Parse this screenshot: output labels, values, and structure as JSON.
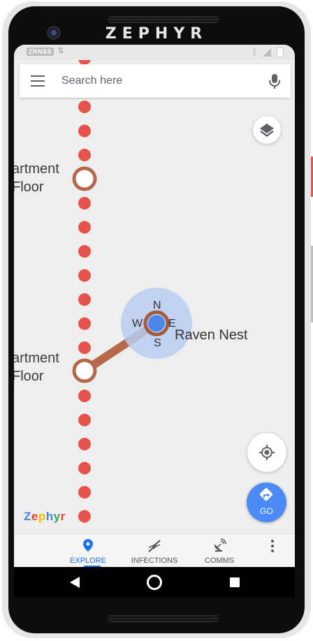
{
  "device": {
    "brand": "ZEPHYR"
  },
  "status_bar": {
    "carrier": "ZRNSS",
    "data_icon": "data-arrows-icon",
    "bluetooth_icon": "bluetooth-icon",
    "signal_icon": "signal-icon",
    "battery_icon": "battery-icon"
  },
  "search": {
    "placeholder": "Search here"
  },
  "map": {
    "labels": {
      "upper_line1": "artment",
      "upper_line2": "Floor",
      "lower_line1": "artment",
      "lower_line2": "Floor",
      "place": "Raven Nest"
    },
    "compass": {
      "n": "N",
      "e": "E",
      "s": "S",
      "w": "W"
    },
    "colors": {
      "route_dot": "#e5534b",
      "link": "#b5694a",
      "user_dot": "#4a86e8",
      "accuracy": "#b9cdf0"
    }
  },
  "watermark": {
    "text": "Zephyr"
  },
  "actions": {
    "go_label": "GO"
  },
  "bottom_nav": {
    "items": [
      {
        "label": "EXPLORE",
        "icon": "explore-pin-icon",
        "active": true
      },
      {
        "label": "INFECTIONS",
        "icon": "dna-icon",
        "active": false
      },
      {
        "label": "COMMS",
        "icon": "satellite-dish-icon",
        "active": false
      }
    ],
    "accent": "#1a73e8"
  }
}
